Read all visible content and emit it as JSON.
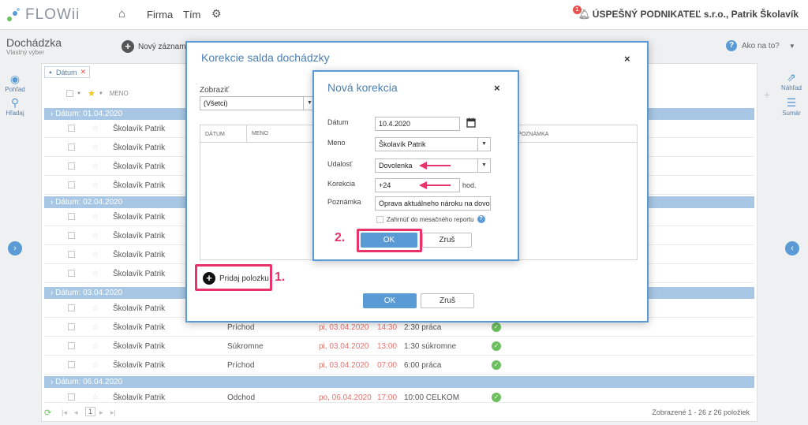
{
  "topbar": {
    "logo_text": "FLOWii",
    "nav": [
      "Firma",
      "Tím"
    ],
    "company": "ÚSPEŠNÝ PODNIKATEĽ s.r.o., Patrik Školavík",
    "notifications": "1"
  },
  "subheader": {
    "title": "Dochádzka",
    "subtitle": "Vlastný výber",
    "new_record": "Nový záznam",
    "help": "Ako na to?"
  },
  "sidebar": {
    "left": [
      "Pohľad",
      "Hľadaj"
    ],
    "right": [
      "Náhľad",
      "Sumár"
    ]
  },
  "grid": {
    "filter_chip": "Dátum",
    "header_name": "MENO",
    "groups": [
      {
        "label": "Dátum: 01.04.2020",
        "rows": [
          {
            "name": "Školavík Patrik"
          },
          {
            "name": "Školavík Patrik"
          },
          {
            "name": "Školavík Patrik"
          },
          {
            "name": "Školavík Patrik"
          }
        ]
      },
      {
        "label": "Dátum: 02.04.2020",
        "rows": [
          {
            "name": "Školavík Patrik"
          },
          {
            "name": "Školavík Patrik"
          },
          {
            "name": "Školavík Patrik"
          },
          {
            "name": "Školavík Patrik"
          }
        ]
      },
      {
        "label": "Dátum: 03.04.2020",
        "rows": [
          {
            "name": "Školavík Patrik",
            "event": "Príchod",
            "date": "pi, 03.04.2020",
            "time": "14:30",
            "desc": "2:30 práca"
          },
          {
            "name": "Školavík Patrik",
            "event": "Súkromne",
            "date": "pi, 03.04.2020",
            "time": "13:00",
            "desc": "1:30 súkromne"
          },
          {
            "name": "Školavík Patrik",
            "event": "Príchod",
            "date": "pi, 03.04.2020",
            "time": "07:00",
            "desc": "6:00 práca"
          }
        ]
      },
      {
        "label": "Dátum: 06.04.2020",
        "rows": [
          {
            "name": "Školavík Patrik",
            "event": "Odchod",
            "date": "po, 06.04.2020",
            "time": "17:00",
            "desc": "10:00 CELKOM"
          }
        ]
      }
    ],
    "footer_page": "1",
    "footer_summary": "Zobrazené 1 - 26 z 26 položiek"
  },
  "outer_dialog": {
    "title": "Korekcie salda dochádzky",
    "show_label": "Zobraziť",
    "show_value": "(Všetci)",
    "col_date": "DÁTUM",
    "col_name": "MENO",
    "col_note": "POZNÁMKA",
    "add_item": "Pridaj polozku",
    "ok": "OK",
    "cancel": "Zruš"
  },
  "inner_dialog": {
    "title": "Nová korekcia",
    "date_label": "Dátum",
    "date_value": "10.4.2020",
    "name_label": "Meno",
    "name_value": "Školavík Patrik",
    "event_label": "Udalosť",
    "event_value": "Dovolenka",
    "correction_label": "Korekcia",
    "correction_value": "+24",
    "correction_unit": "hod.",
    "note_label": "Poznámka",
    "note_value": "Oprava aktuálneho nároku na dovolen",
    "include_report": "Zahrnúť do mesačného reportu",
    "ok": "OK",
    "cancel": "Zruš"
  },
  "annotations": {
    "step1": "1.",
    "step2": "2."
  },
  "colors": {
    "accent": "#5b9bd5",
    "highlight": "#e8336b",
    "group_row": "#a7c7e4"
  }
}
